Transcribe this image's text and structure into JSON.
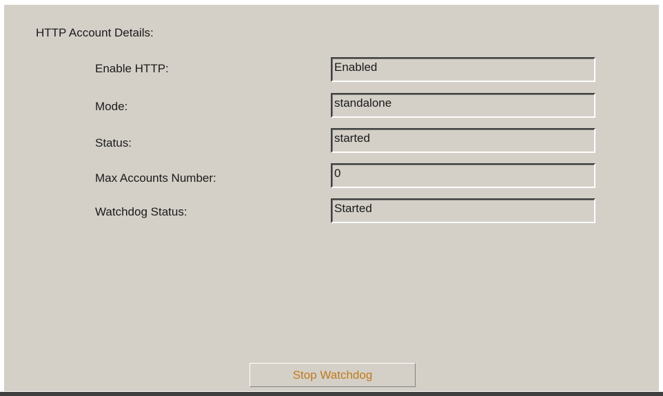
{
  "section": {
    "title": "HTTP Account Details:"
  },
  "fields": [
    {
      "label": "Enable HTTP:",
      "value": "Enabled"
    },
    {
      "label": "Mode:",
      "value": "standalone"
    },
    {
      "label": "Status:",
      "value": "started"
    },
    {
      "label": "Max Accounts Number:",
      "value": "0"
    },
    {
      "label": "Watchdog Status:",
      "value": "Started"
    }
  ],
  "actions": {
    "stop_watchdog_label": "Stop Watchdog"
  },
  "colors": {
    "panel_background": "#d4d0c8",
    "button_text": "#c07a1a",
    "text": "#1a1a1a"
  }
}
